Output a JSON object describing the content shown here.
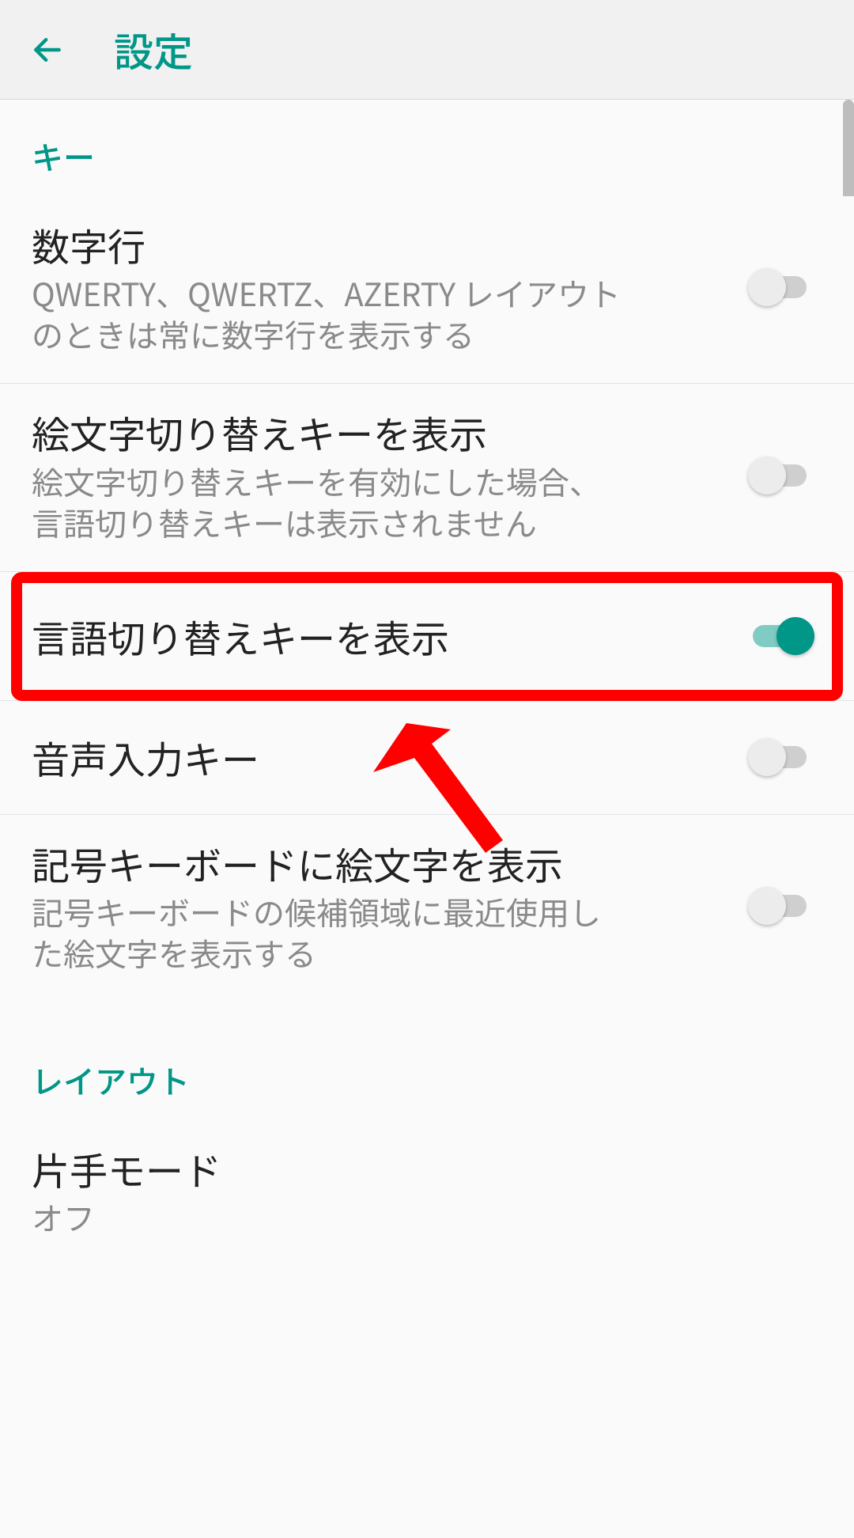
{
  "header": {
    "title": "設定"
  },
  "sections": {
    "keys": {
      "header": "キー",
      "number_row": {
        "title": "数字行",
        "desc": "QWERTY、QWERTZ、AZERTY レイアウトのときは常に数字行を表示する",
        "on": false
      },
      "emoji_switch": {
        "title": "絵文字切り替えキーを表示",
        "desc": "絵文字切り替えキーを有効にした場合、言語切り替えキーは表示されません",
        "on": false
      },
      "lang_switch": {
        "title": "言語切り替えキーを表示",
        "on": true
      },
      "voice_input": {
        "title": "音声入力キー",
        "on": false
      },
      "symbol_emoji": {
        "title": "記号キーボードに絵文字を表示",
        "desc": "記号キーボードの候補領域に最近使用した絵文字を表示する",
        "on": false
      }
    },
    "layout": {
      "header": "レイアウト",
      "one_hand": {
        "title": "片手モード",
        "desc": "オフ"
      }
    }
  },
  "annotation": {
    "highlighted_item": "lang_switch"
  }
}
